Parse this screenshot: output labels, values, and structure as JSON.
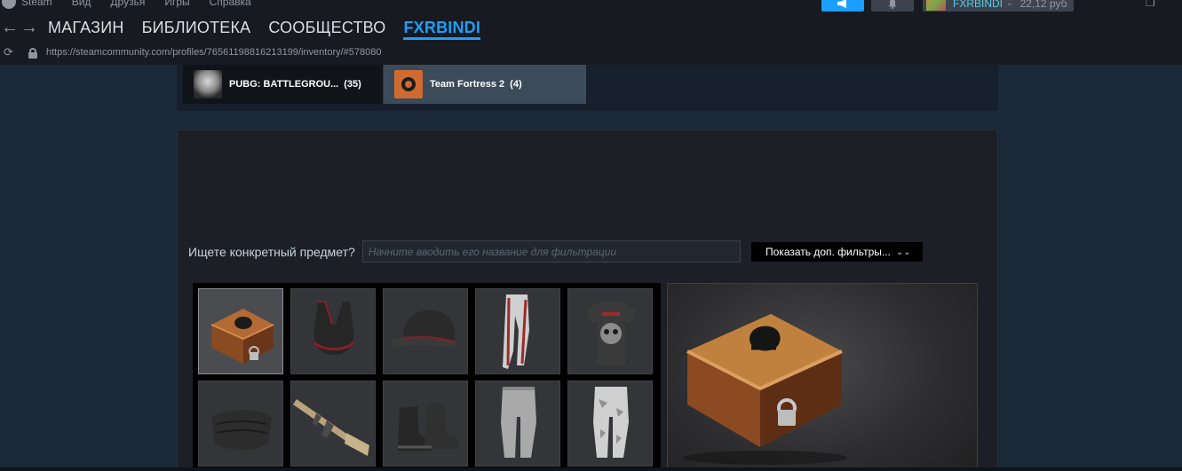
{
  "menubar": {
    "items": [
      "Steam",
      "Вид",
      "Друзья",
      "Игры",
      "Справка"
    ]
  },
  "account": {
    "name": "FXRBINDI",
    "balance": "22,12 руб"
  },
  "nav": {
    "tabs": [
      "МАГАЗИН",
      "БИБЛИОТЕКА",
      "СООБЩЕСТВО",
      "FXRBINDI"
    ],
    "active": "FXRBINDI"
  },
  "url": "https://steamcommunity.com/profiles/76561198816213199/inventory/#578080",
  "games": [
    {
      "name": "PUBG: BATTLEGROU...",
      "count": "(35)",
      "icon": "pubg-helmet-icon"
    },
    {
      "name": "Team Fortress 2",
      "count": "(4)",
      "icon": "tf2-icon"
    }
  ],
  "filter": {
    "label": "Ищете конкретный предмет?",
    "placeholder": "Начните вводить его название для фильтрации",
    "more_button": "Показать доп. фильтры..."
  },
  "items": [
    {
      "icon": "crate-icon",
      "selected": true
    },
    {
      "icon": "sports-bra-icon"
    },
    {
      "icon": "baseball-cap-icon"
    },
    {
      "icon": "track-pants-icon"
    },
    {
      "icon": "skull-tshirt-icon"
    },
    {
      "icon": "face-mask-icon"
    },
    {
      "icon": "rifle-icon"
    },
    {
      "icon": "boots-icon"
    },
    {
      "icon": "jogger-pants-icon"
    },
    {
      "icon": "camo-pants-icon"
    }
  ],
  "colors": {
    "accent": "#1a9fff",
    "background": "#1b2838",
    "panel": "#1c2026"
  }
}
